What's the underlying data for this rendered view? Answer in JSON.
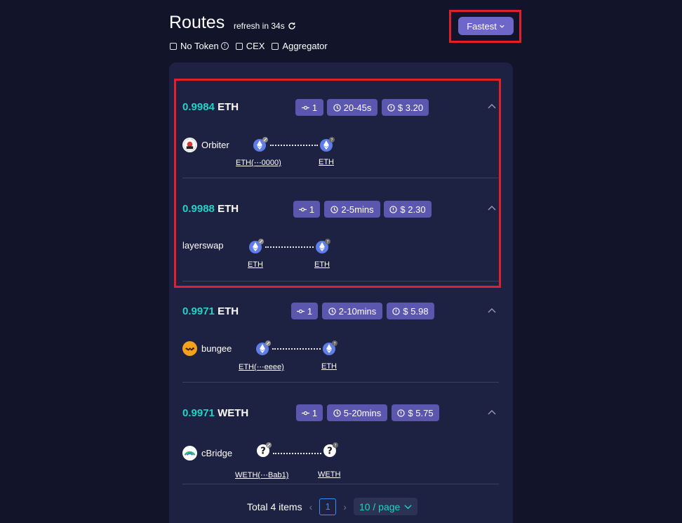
{
  "header": {
    "title": "Routes",
    "refresh_text": "refresh in 34s"
  },
  "filters": {
    "no_token": "No Token",
    "cex": "CEX",
    "aggregator": "Aggregator"
  },
  "sort": {
    "label": "Fastest"
  },
  "routes": [
    {
      "amount": "0.9984",
      "token": "ETH",
      "steps": "1",
      "time": "20-45s",
      "fee": "$ 3.20",
      "provider": "Orbiter",
      "from_token": "ETH(⋯0000)",
      "to_token": "ETH"
    },
    {
      "amount": "0.9988",
      "token": "ETH",
      "steps": "1",
      "time": "2-5mins",
      "fee": "$ 2.30",
      "provider": "layerswap",
      "from_token": "ETH",
      "to_token": "ETH"
    },
    {
      "amount": "0.9971",
      "token": "ETH",
      "steps": "1",
      "time": "2-10mins",
      "fee": "$ 5.98",
      "provider": "bungee",
      "from_token": "ETH(⋯eeee)",
      "to_token": "ETH"
    },
    {
      "amount": "0.9971",
      "token": "WETH",
      "steps": "1",
      "time": "5-20mins",
      "fee": "$ 5.75",
      "provider": "cBridge",
      "from_token": "WETH(⋯Bab1)",
      "to_token": "WETH"
    }
  ],
  "pagination": {
    "total": "Total 4 items",
    "page": "1",
    "per_page": "10 / page"
  },
  "colors": {
    "background": "#121529",
    "panel": "#1d2142",
    "accent_amount": "#22d3c5",
    "badge": "#5c57ae",
    "sort_button": "#6f66c9",
    "highlight": "#e0202c"
  }
}
